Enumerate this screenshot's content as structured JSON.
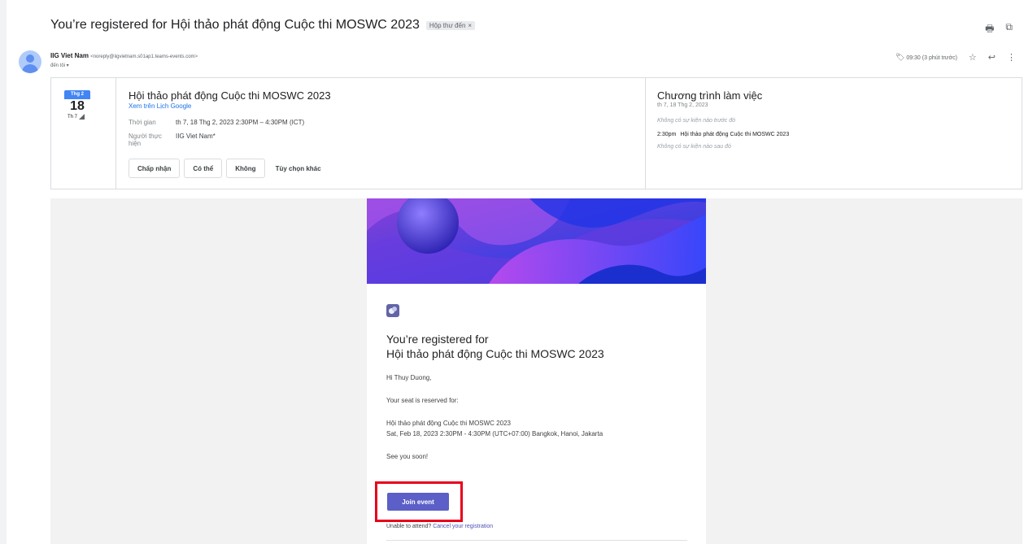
{
  "email": {
    "subject": "You’re registered for Hội thảo phát động Cuộc thi MOSWC 2023",
    "label": "Hộp thư đến",
    "sender_name": "IIG Viet Nam",
    "sender_email": "<noreply@iigvietnam.s01ap1.teams-events.com>",
    "to_line": "đến tôi ▾",
    "time": "09:30 (3 phút trước)"
  },
  "calendar": {
    "month": "Thg 2",
    "day": "18",
    "weekday": "Th 7",
    "event_title": "Hội thảo phát động Cuộc thi MOSWC 2023",
    "gcal_link": "Xem trên Lịch Google",
    "time_label": "Thời gian",
    "time_value": "th 7, 18 Thg 2, 2023 2:30PM – 4:30PM (ICT)",
    "organizer_label": "Người thực hiện",
    "organizer_value": "IIG Viet Nam*",
    "rsvp": {
      "accept": "Chấp nhận",
      "maybe": "Có thể",
      "decline": "Không",
      "more": "Tùy chọn khác"
    },
    "agenda": {
      "title": "Chương trình làm việc",
      "date": "th 7, 18 Thg 2, 2023",
      "before": "Không có sự kiện nào trước đó",
      "item_time": "2:30pm",
      "item_title": "Hội thảo phát động Cuộc thi MOSWC 2023",
      "after": "Không có sự kiện nào sau đó"
    }
  },
  "body": {
    "reg_line1": "You’re registered for",
    "reg_line2": "Hội thảo phát động Cuộc thi MOSWC 2023",
    "greeting": "Hi Thuy Duong,",
    "seat": "Your seat is reserved for:",
    "event_name": "Hội thảo phát động Cuộc thi MOSWC 2023",
    "event_when": "Sat, Feb 18, 2023 2:30PM - 4:30PM (UTC+07:00) Bangkok, Hanoi, Jakarta",
    "see_you": "See you soon!",
    "join_label": "Join event",
    "unable_text": "Unable to attend?",
    "cancel_link": "Cancel your registration"
  },
  "icons": {
    "print": "print-icon",
    "popout": "open-in-new-icon",
    "star": "star-icon",
    "reply": "reply-icon",
    "more": "more-vert-icon",
    "label_icon": "label-icon"
  }
}
